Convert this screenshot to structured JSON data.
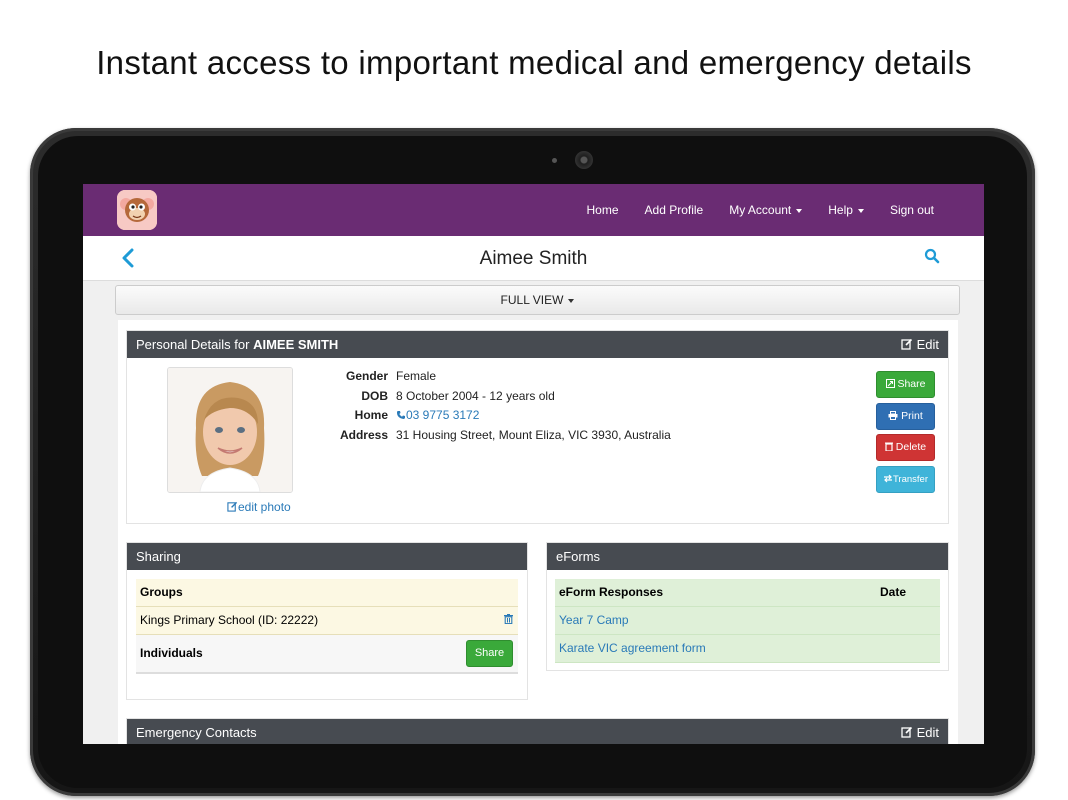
{
  "headline": "Instant access to important medical and emergency details",
  "nav": {
    "items": [
      "Home",
      "Add Profile",
      "My Account",
      "Help",
      "Sign out"
    ]
  },
  "page": {
    "title": "Aimee Smith",
    "view_label": "FULL VIEW"
  },
  "personal": {
    "heading_prefix": "Personal Details for ",
    "heading_name": "AIMEE SMITH",
    "edit_label": "Edit",
    "edit_photo_label": "edit photo",
    "fields": [
      {
        "label": "Gender",
        "value": "Female"
      },
      {
        "label": "DOB",
        "value": "8 October 2004 - 12 years old"
      },
      {
        "label": "Home",
        "value": "03 9775 3172"
      },
      {
        "label": "Address",
        "value": "31 Housing Street, Mount Eliza, VIC 3930, Australia"
      }
    ],
    "actions": {
      "share": "Share",
      "print": "Print",
      "delete": "Delete",
      "transfer": "Transfer"
    }
  },
  "sharing": {
    "heading": "Sharing",
    "groups_label": "Groups",
    "groups": [
      "Kings Primary School (ID: 22222)"
    ],
    "individuals_label": "Individuals",
    "share_button": "Share"
  },
  "eforms": {
    "heading": "eForms",
    "col_responses": "eForm Responses",
    "col_date": "Date",
    "rows": [
      "Year 7 Camp",
      "Karate VIC agreement form"
    ]
  },
  "emergency": {
    "heading": "Emergency Contacts",
    "edit_label": "Edit"
  },
  "colors": {
    "nav_bg": "#6a2c73",
    "accent_blue": "#1e9bd6",
    "panel_head": "#474b51"
  }
}
